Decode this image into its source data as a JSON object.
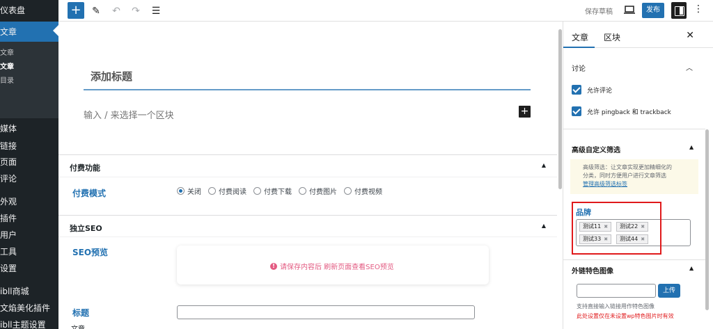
{
  "admin_menu": {
    "dashboard": "仪表盘",
    "posts": "文章",
    "posts_sub": [
      "文章",
      "文章",
      "目录"
    ],
    "media": "媒体",
    "links": "链接",
    "pages": "页面",
    "comments": "评论",
    "appearance": "外观",
    "plugins": "插件",
    "users": "用户",
    "tools": "工具",
    "settings": "设置",
    "store": "ibll商城",
    "beautify": "文焰美化插件",
    "theme": "ibll主题设置"
  },
  "toolbar": {
    "save_draft": "保存草稿",
    "publish": "发布",
    "add_icon": "plus-icon",
    "tools_icon": "pencil-icon",
    "undo_icon": "undo-icon",
    "redo_icon": "redo-icon",
    "outline_icon": "list-icon",
    "more_icon": "more-vertical-icon"
  },
  "editor": {
    "title_placeholder": "添加标题",
    "block_placeholder": "输入 / 来选择一个区块"
  },
  "metaboxes": {
    "paid": {
      "header": "付费功能",
      "mode_label": "付费模式",
      "options": [
        "关闭",
        "付费阅读",
        "付费下载",
        "付费图片",
        "付费视频"
      ],
      "selected": "关闭"
    },
    "seo": {
      "header": "独立SEO",
      "preview_label": "SEO预览",
      "preview_message": "请保存内容后 刷新页面查看SEO预览",
      "title_label": "标题"
    },
    "footer_breadcrumb": "文章"
  },
  "settings_panel": {
    "tabs": [
      "文章",
      "区块"
    ],
    "discussion": {
      "title": "讨论",
      "allow_comments": "允许评论",
      "allow_pingbacks": "允许 pingback 和 trackback"
    },
    "advanced_filter": {
      "title": "高级自定义筛选",
      "notice_line1": "高级筛选：让文章实现更加精细化的",
      "notice_line2": "分类，同时方便用户进行文章筛选",
      "notice_link": "管理高级筛选标签"
    },
    "brand": {
      "label": "品牌",
      "tags": [
        "测试11",
        "测试22",
        "测试33",
        "测试44"
      ]
    },
    "external_image": {
      "title": "外链特色图像",
      "upload": "上传",
      "hint": "支持直接输入链接用作特色图像",
      "warning": "此处设置仅在未设置wp特色图片时有效"
    }
  },
  "colors": {
    "accent": "#2271b1",
    "admin_bg": "#1d2327",
    "highlight_red": "#e0191b"
  }
}
